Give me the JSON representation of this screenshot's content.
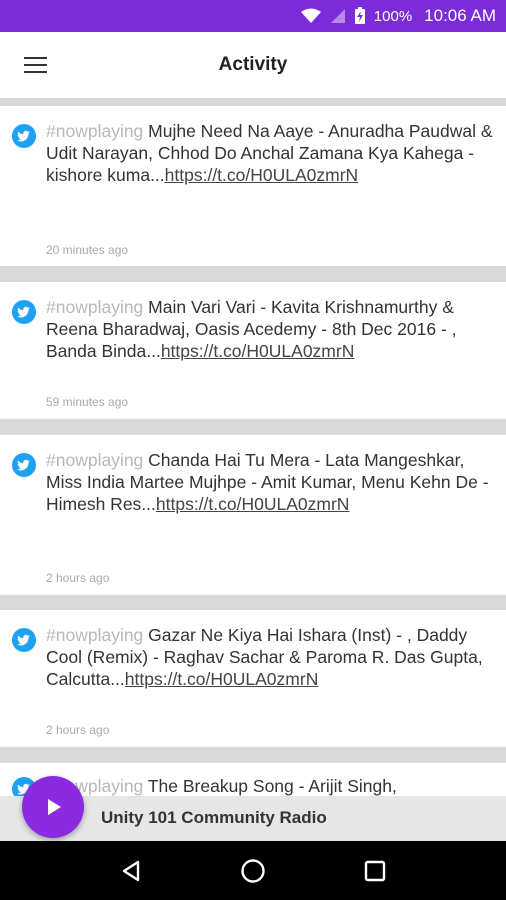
{
  "status_bar": {
    "battery": "100%",
    "time": "10:06 AM"
  },
  "app_bar": {
    "title": "Activity"
  },
  "feed": [
    {
      "tag": "#nowplaying",
      "text": " Mujhe Need Na Aaye - Anuradha Paudwal & Udit Narayan, Chhod Do Anchal Zamana Kya Kahega - kishore kuma...",
      "link": "https://t.co/H0ULA0zmrN",
      "time": "20 minutes ago"
    },
    {
      "tag": "#nowplaying",
      "text": " Main Vari Vari - Kavita Krishnamurthy & Reena Bharadwaj, Oasis Acedemy  - 8th Dec 2016 - , Banda Binda...",
      "link": "https://t.co/H0ULA0zmrN",
      "time": "59 minutes ago"
    },
    {
      "tag": "#nowplaying",
      "text": " Chanda Hai Tu Mera - Lata Mangeshkar, Miss India Martee Mujhpe - Amit Kumar, Menu Kehn De - Himesh Res...",
      "link": "https://t.co/H0ULA0zmrN",
      "time": "2 hours ago"
    },
    {
      "tag": "#nowplaying",
      "text": " Gazar Ne Kiya Hai Ishara (Inst) - , Daddy Cool (Remix) - Raghav Sachar & Paroma R. Das Gupta, Calcutta...",
      "link": "https://t.co/H0ULA0zmrN",
      "time": "2 hours ago"
    },
    {
      "tag": "#nowplaying",
      "text": " The Breakup Song - Arijit Singh,",
      "link": "",
      "time": ""
    }
  ],
  "player": {
    "station": "Unity 101 Community Radio"
  },
  "colors": {
    "status_bar": "#7b2bd9",
    "play_button": "#8a2be2",
    "twitter": "#1da1f2"
  }
}
